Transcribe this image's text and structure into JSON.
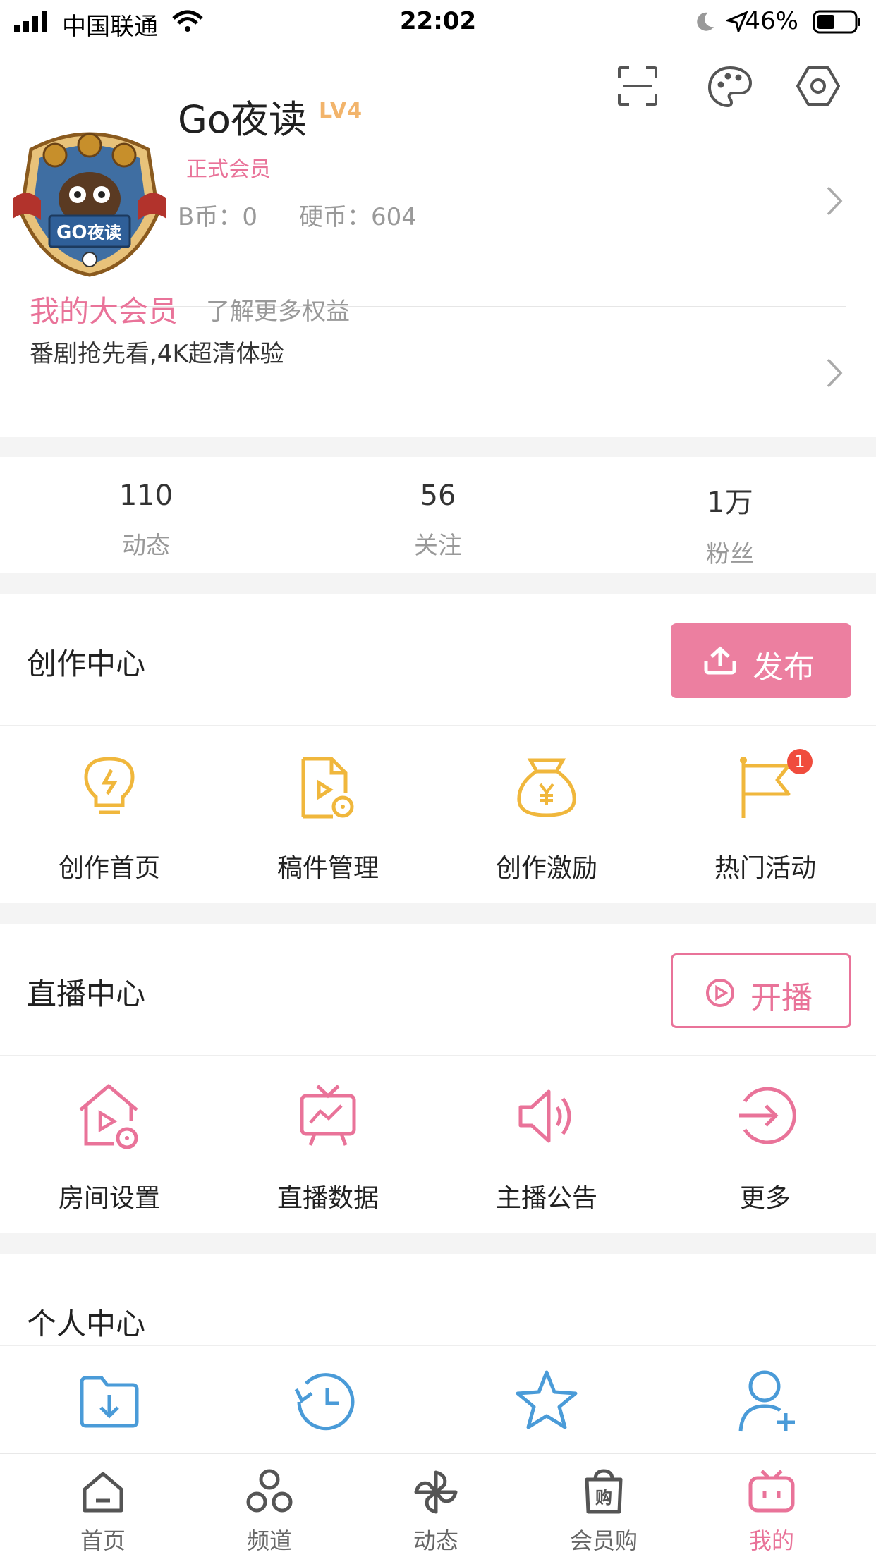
{
  "status_bar": {
    "carrier": "中国联通",
    "time": "22:02",
    "battery": "46%"
  },
  "profile": {
    "avatar_text": "GO 夜读",
    "username": "Go夜读",
    "level": "LV4",
    "member_tag": "正式会员",
    "b_coins": "B币：0",
    "coins": "硬币：604"
  },
  "vip": {
    "title": "我的大会员",
    "more": "了解更多权益",
    "subtitle": "番剧抢先看,4K超清体验"
  },
  "stats": [
    {
      "value": "110",
      "label": "动态"
    },
    {
      "value": "56",
      "label": "关注"
    },
    {
      "value": "1万",
      "label": "粉丝"
    }
  ],
  "creation": {
    "title": "创作中心",
    "button": "发布",
    "items": [
      {
        "label": "创作首页",
        "icon": "lightbulb-icon"
      },
      {
        "label": "稿件管理",
        "icon": "manuscript-icon"
      },
      {
        "label": "创作激励",
        "icon": "money-bag-icon"
      },
      {
        "label": "热门活动",
        "icon": "flag-icon",
        "badge": "1"
      }
    ]
  },
  "live": {
    "title": "直播中心",
    "button": "开播",
    "items": [
      {
        "label": "房间设置",
        "icon": "room-settings-icon"
      },
      {
        "label": "直播数据",
        "icon": "live-data-icon"
      },
      {
        "label": "主播公告",
        "icon": "speaker-icon"
      },
      {
        "label": "更多",
        "icon": "arrow-circle-icon"
      }
    ]
  },
  "personal": {
    "title": "个人中心",
    "items": [
      {
        "icon": "download-folder-icon"
      },
      {
        "icon": "history-icon"
      },
      {
        "icon": "star-icon"
      },
      {
        "icon": "add-user-icon"
      }
    ]
  },
  "tabs": [
    {
      "label": "首页",
      "icon": "home-icon"
    },
    {
      "label": "频道",
      "icon": "channel-icon"
    },
    {
      "label": "动态",
      "icon": "pinwheel-icon"
    },
    {
      "label": "会员购",
      "icon": "shopping-bag-icon"
    },
    {
      "label": "我的",
      "icon": "tv-icon",
      "active": true
    }
  ],
  "colors": {
    "pink": "#e97399",
    "yellow": "#f0b73c",
    "blue": "#4a9bd8",
    "gray_text": "#999999"
  }
}
